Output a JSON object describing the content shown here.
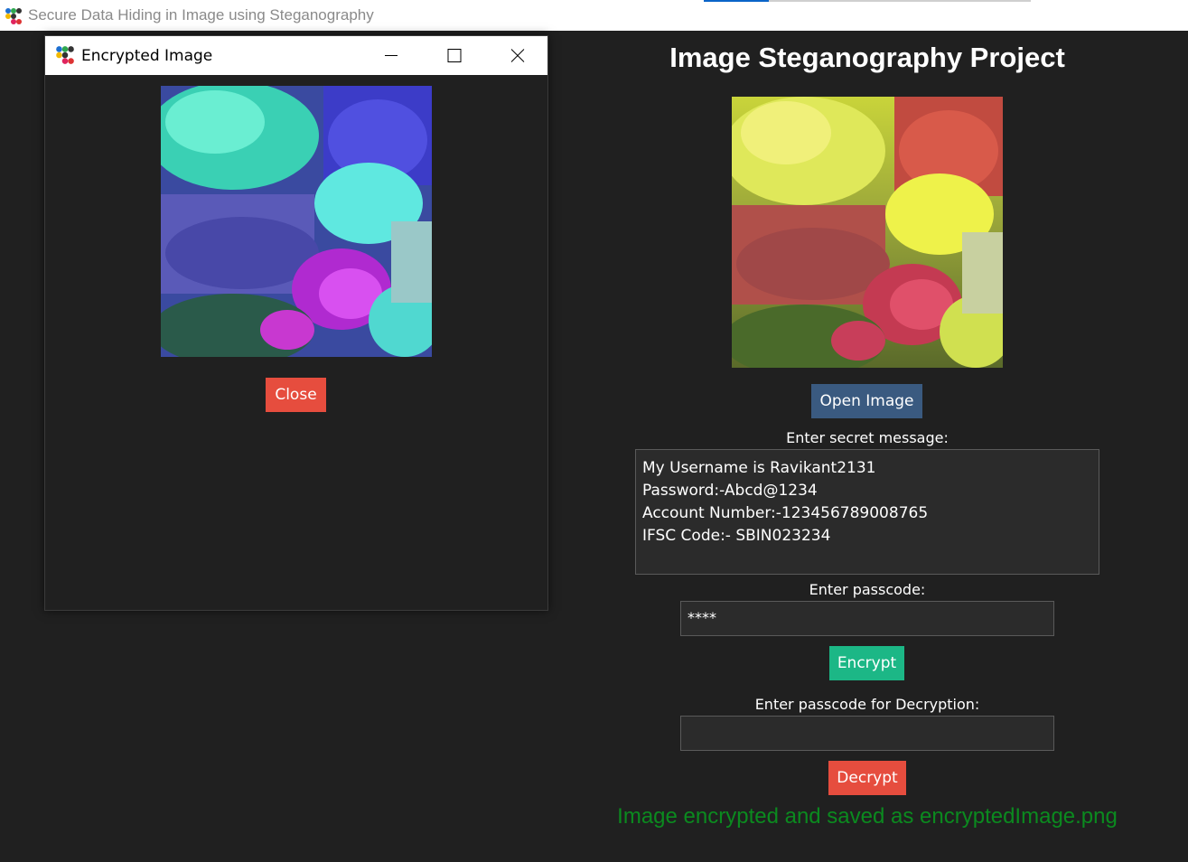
{
  "window": {
    "title": "Secure Data Hiding in Image using Steganography",
    "icon": "app-dots-icon"
  },
  "main": {
    "heading": "Image Steganography Project",
    "open_button": "Open Image",
    "secret_label": "Enter secret message:",
    "secret_message": "My Username is Ravikant2131\nPassword:-Abcd@1234\nAccount Number:-123456789008765\nIFSC Code:- SBIN023234",
    "passcode_label": "Enter passcode:",
    "passcode_value": "****",
    "encrypt_button": "Encrypt",
    "decrypt_label": "Enter passcode for Decryption:",
    "decrypt_value": "",
    "decrypt_button": "Decrypt",
    "status": "Image encrypted and saved as encryptedImage.png",
    "status_color": "#0b8a1f"
  },
  "dialog": {
    "title": "Encrypted Image",
    "close_button": "Close"
  },
  "colors": {
    "background": "#202020",
    "open_button": "#3a5a80",
    "encrypt_button": "#1cb786",
    "decrypt_button": "#e64d3e"
  }
}
